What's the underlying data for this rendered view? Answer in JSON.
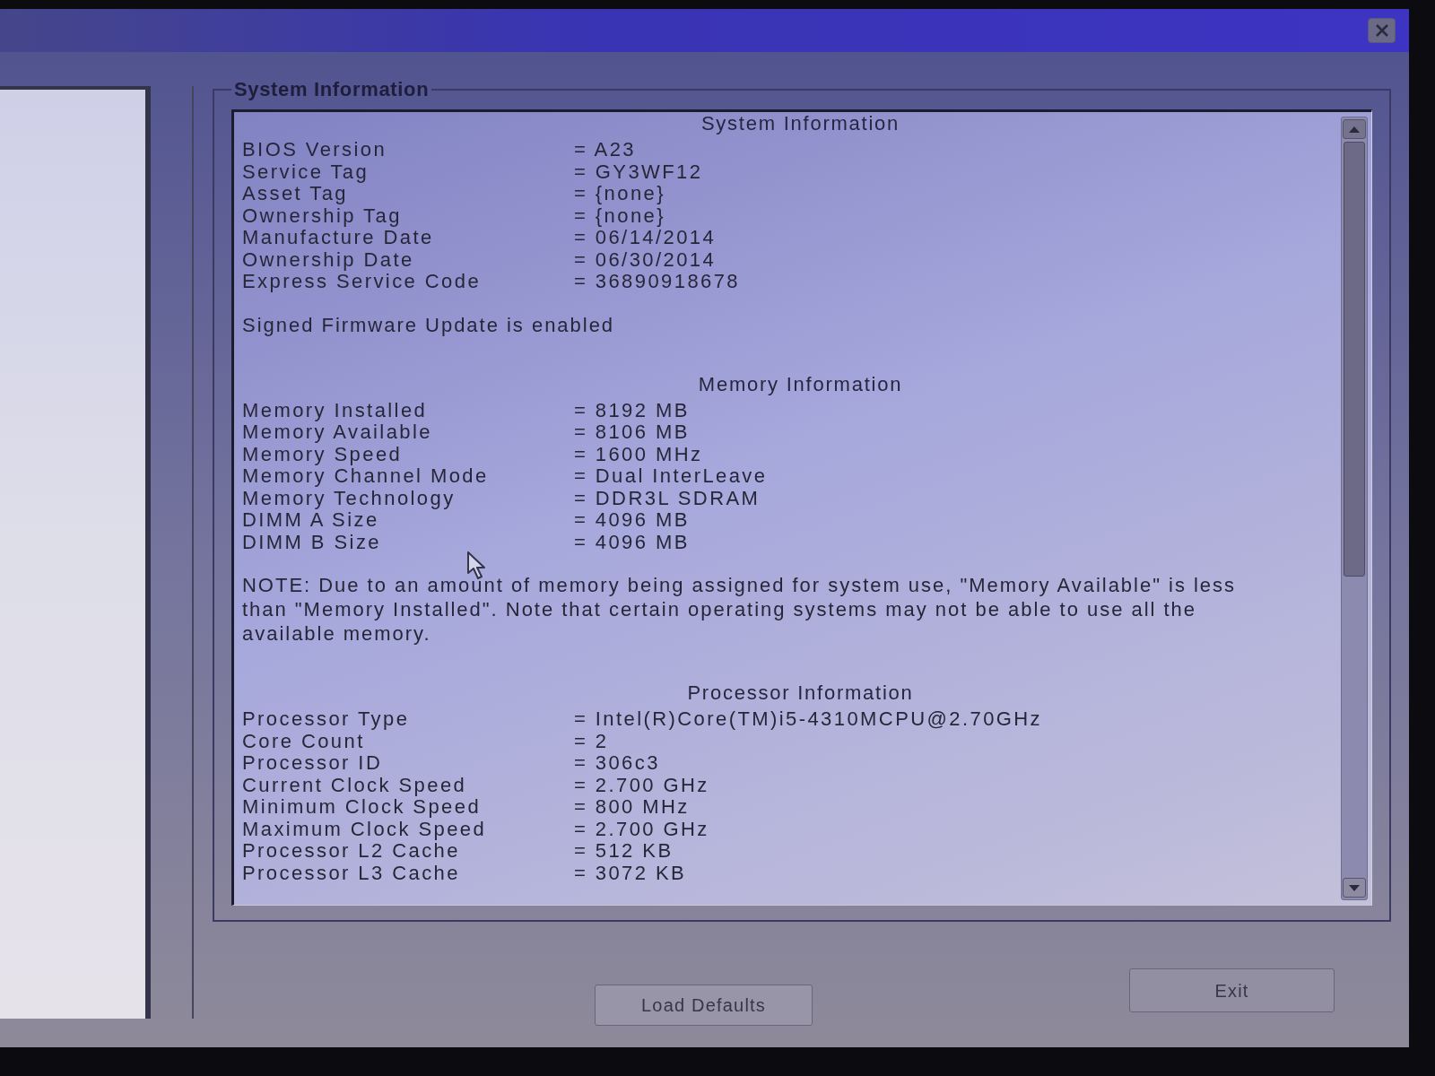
{
  "group_box": {
    "title": "System Information"
  },
  "sections": [
    {
      "kind": "table",
      "heading": "System Information",
      "rows": [
        {
          "label": "BIOS Version",
          "value": "= A23"
        },
        {
          "label": "Service Tag",
          "value": "= GY3WF12"
        },
        {
          "label": "Asset Tag",
          "value": "= {none}"
        },
        {
          "label": "Ownership Tag",
          "value": "= {none}"
        },
        {
          "label": "Manufacture Date",
          "value": "= 06/14/2014"
        },
        {
          "label": "Ownership Date",
          "value": "= 06/30/2014"
        },
        {
          "label": "Express Service Code",
          "value": "= 36890918678"
        }
      ]
    },
    {
      "kind": "note",
      "text": "Signed Firmware Update is enabled"
    },
    {
      "kind": "table",
      "heading": "Memory Information",
      "rows": [
        {
          "label": "Memory Installed",
          "value": "= 8192 MB"
        },
        {
          "label": "Memory Available",
          "value": "= 8106 MB"
        },
        {
          "label": "Memory Speed",
          "value": "= 1600 MHz"
        },
        {
          "label": "Memory Channel Mode",
          "value": "= Dual InterLeave"
        },
        {
          "label": "Memory Technology",
          "value": "= DDR3L SDRAM"
        },
        {
          "label": "DIMM A Size",
          "value": "= 4096 MB"
        },
        {
          "label": "DIMM B Size",
          "value": "= 4096 MB"
        }
      ]
    },
    {
      "kind": "note",
      "text": "NOTE: Due to an amount of memory being assigned for system use, \"Memory Available\" is less than \"Memory Installed\". Note that certain operating systems may not be able to use all the available memory."
    },
    {
      "kind": "table",
      "heading": "Processor Information",
      "rows": [
        {
          "label": "Processor Type",
          "value": "= Intel(R)Core(TM)i5-4310MCPU@2.70GHz"
        },
        {
          "label": "Core Count",
          "value": "= 2"
        },
        {
          "label": "Processor ID",
          "value": "= 306c3"
        },
        {
          "label": "Current Clock Speed",
          "value": "= 2.700 GHz"
        },
        {
          "label": "Minimum Clock Speed",
          "value": "= 800 MHz"
        },
        {
          "label": "Maximum Clock Speed",
          "value": "= 2.700 GHz"
        },
        {
          "label": "Processor L2 Cache",
          "value": "= 512 KB"
        },
        {
          "label": "Processor L3 Cache",
          "value": "= 3072 KB"
        }
      ]
    }
  ],
  "buttons": [
    "Load Defaults",
    "Exit"
  ]
}
